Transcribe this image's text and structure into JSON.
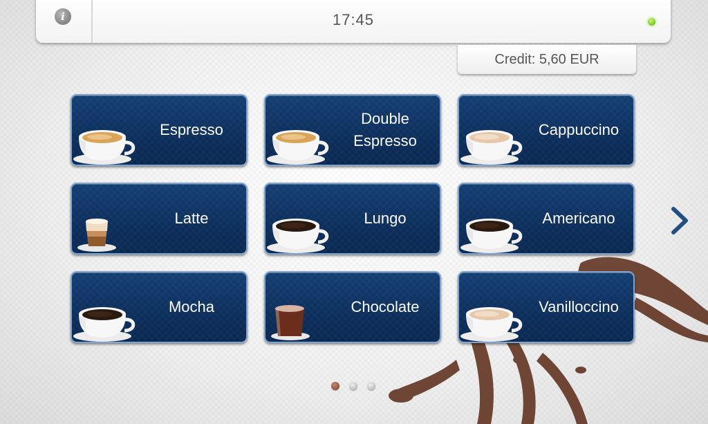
{
  "header": {
    "info_icon": "info-icon",
    "info_glyph": "i",
    "time": "17:45",
    "status_icon": "status-led-icon",
    "status_color": "#6fbf1a"
  },
  "credit": {
    "text": "Credit: 5,60 EUR"
  },
  "menu": {
    "items": [
      {
        "label": "Espresso",
        "icon": "espresso-cup-icon",
        "drink": "crema"
      },
      {
        "label": "Double\nEspresso",
        "icon": "double-espresso-cup-icon",
        "drink": "crema"
      },
      {
        "label": "Cappuccino",
        "icon": "cappuccino-cup-icon",
        "drink": "foam"
      },
      {
        "label": "Latte",
        "icon": "latte-glass-icon",
        "drink": "latte"
      },
      {
        "label": "Lungo",
        "icon": "lungo-cup-icon",
        "drink": "black"
      },
      {
        "label": "Americano",
        "icon": "americano-cup-icon",
        "drink": "black"
      },
      {
        "label": "Mocha",
        "icon": "mocha-cup-icon",
        "drink": "black"
      },
      {
        "label": "Chocolate",
        "icon": "chocolate-glass-icon",
        "drink": "chocolate"
      },
      {
        "label": "Vanilloccino",
        "icon": "vanilloccino-cup-icon",
        "drink": "foam"
      }
    ]
  },
  "pagination": {
    "pages": 3,
    "current": 1
  },
  "nav": {
    "next_icon": "chevron-right-icon"
  },
  "colors": {
    "tile": "#0d2f5c",
    "tile_border": "#7ea4cf",
    "accent": "#1f4f86"
  }
}
